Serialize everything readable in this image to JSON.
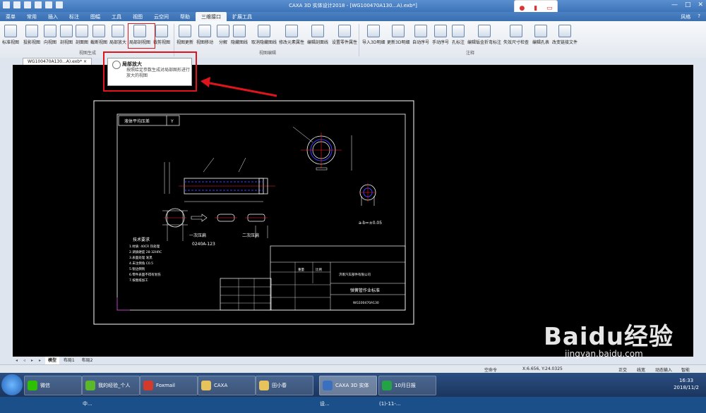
{
  "window": {
    "title": "CAXA 3D 实体设计2018 - [WG100470A130...A).exb*]"
  },
  "menu": {
    "tabs": [
      "菜单",
      "常用",
      "插入",
      "标注",
      "图幅",
      "工具",
      "视图",
      "云空间",
      "帮助",
      "三维接口",
      "扩展工具"
    ],
    "active": "三维接口",
    "right_items": [
      "风格",
      "?"
    ]
  },
  "ribbon": {
    "buttons": [
      "标准视图",
      "投影视图",
      "向视图",
      "剖视图",
      "剖面图",
      "截断视图",
      "局部放大",
      "局部剖视图",
      "裁剪视图",
      "视图更新",
      "视图移动",
      "分解",
      "隐藏图线",
      "取消隐藏图线",
      "修改元素属性",
      "编辑剖面线",
      "设置零件属性",
      "导入3D明细",
      "更新3D明细",
      "自动序号",
      "手动序号",
      "孔标注",
      "编辑钣金折弯标注",
      "失效尺寸检查",
      "编辑孔表",
      "改变链接文件"
    ],
    "groups": [
      "视图生成",
      "视图编辑",
      "注释"
    ]
  },
  "document_tab": {
    "label": "WG100470A130...A).exb*"
  },
  "tooltip": {
    "title": "局部放大",
    "body": "按照给定参数生成对局部图形进行放大的视图"
  },
  "sheet_tabs": {
    "nav": [
      "◂",
      "◃",
      "▸",
      "▸"
    ],
    "items": [
      "模型",
      "布局1",
      "布局2"
    ],
    "active": "模型"
  },
  "statusbar": {
    "left": "空命令",
    "coords": "X:6.656, Y:24.0325",
    "items": [
      "正交",
      "线宽",
      "动态输入",
      "智能"
    ]
  },
  "drawing": {
    "table_title": "液体平均压差",
    "table_code": "Y",
    "label_first": "一次压扁",
    "label_code": "0240A-123",
    "label_second": "二次压扁",
    "tolerance": "a-b=±0.05",
    "tech_title": "技术要求",
    "tech_lines": [
      "1.材质: 40CR 热处理",
      "2.调质硬度 28-32HRC",
      "3.表面处理 发黑",
      "4.未注倒角 C0.5",
      "5.锐边倒钝",
      "6.零件表面不得有划伤",
      "7.按图纸加工"
    ],
    "company": "济南汽车部件有限公司",
    "part_name": "弹簧管作业标准",
    "part_no": "WG100470A130",
    "scale_label": "比例",
    "weight_label": "重量"
  },
  "taskbar": {
    "apps": [
      "微信",
      "我的经验_个人中...",
      "Foxmail",
      "CAXA",
      "田小春",
      "CAXA 3D 实体设...",
      "10月日报(1)-11-..."
    ],
    "active": "CAXA 3D 实体设...",
    "time": "16:33",
    "date": "2018/11/2"
  },
  "watermark": {
    "main": "Baidu经验",
    "sub": "jingyan.baidu.com"
  },
  "colors": {
    "highlight": "#e0141c",
    "ribbon_bg": "#e8edf3",
    "canvas": "#000000",
    "drawing_white": "#ffffff",
    "drawing_blue": "#3b3bff",
    "drawing_red": "#ff2020"
  }
}
